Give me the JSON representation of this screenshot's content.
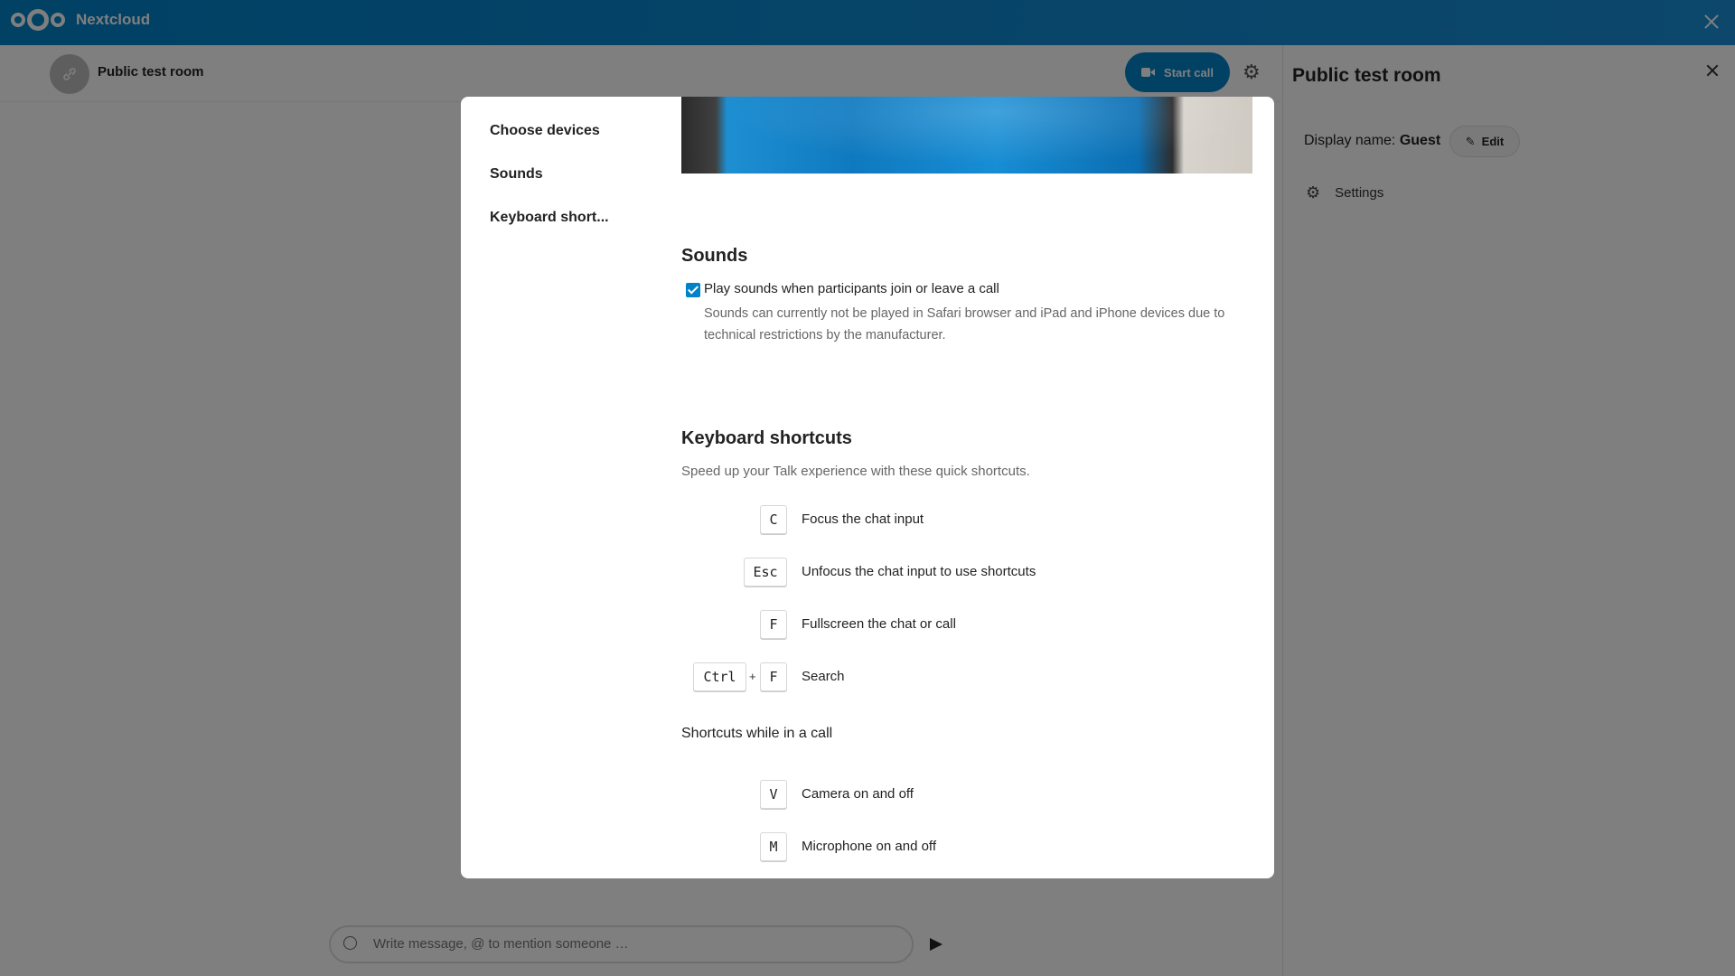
{
  "header": {
    "app_name": "Nextcloud"
  },
  "room": {
    "title": "Public test room",
    "start_call_label": "Start call"
  },
  "sidebar": {
    "title": "Public test room",
    "display_name_label": "Display name:",
    "display_name_value": "Guest",
    "edit_label": "Edit",
    "settings_label": "Settings"
  },
  "chat": {
    "placeholder": "Write message, @ to mention someone …"
  },
  "modal": {
    "nav": [
      "Choose devices",
      "Sounds",
      "Keyboard short..."
    ],
    "sounds": {
      "heading": "Sounds",
      "checkbox_label": "Play sounds when participants join or leave a call",
      "checkbox_checked": true,
      "hint": "Sounds can currently not be played in Safari browser and iPad and iPhone devices due to technical restrictions by the manufacturer."
    },
    "shortcuts": {
      "heading": "Keyboard shortcuts",
      "description": "Speed up your Talk experience with these quick shortcuts.",
      "plus": "+",
      "items": [
        {
          "keys": [
            "C"
          ],
          "label": "Focus the chat input"
        },
        {
          "keys": [
            "Esc"
          ],
          "label": "Unfocus the chat input to use shortcuts"
        },
        {
          "keys": [
            "F"
          ],
          "label": "Fullscreen the chat or call"
        },
        {
          "keys": [
            "Ctrl",
            "F"
          ],
          "label": "Search"
        }
      ],
      "in_call_heading": "Shortcuts while in a call",
      "in_call_items": [
        {
          "keys": [
            "V"
          ],
          "label": "Camera on and off"
        },
        {
          "keys": [
            "M"
          ],
          "label": "Microphone on and off"
        }
      ]
    }
  },
  "colors": {
    "primary": "#0082c9",
    "overlay": "rgba(0,0,0,0.5)"
  }
}
